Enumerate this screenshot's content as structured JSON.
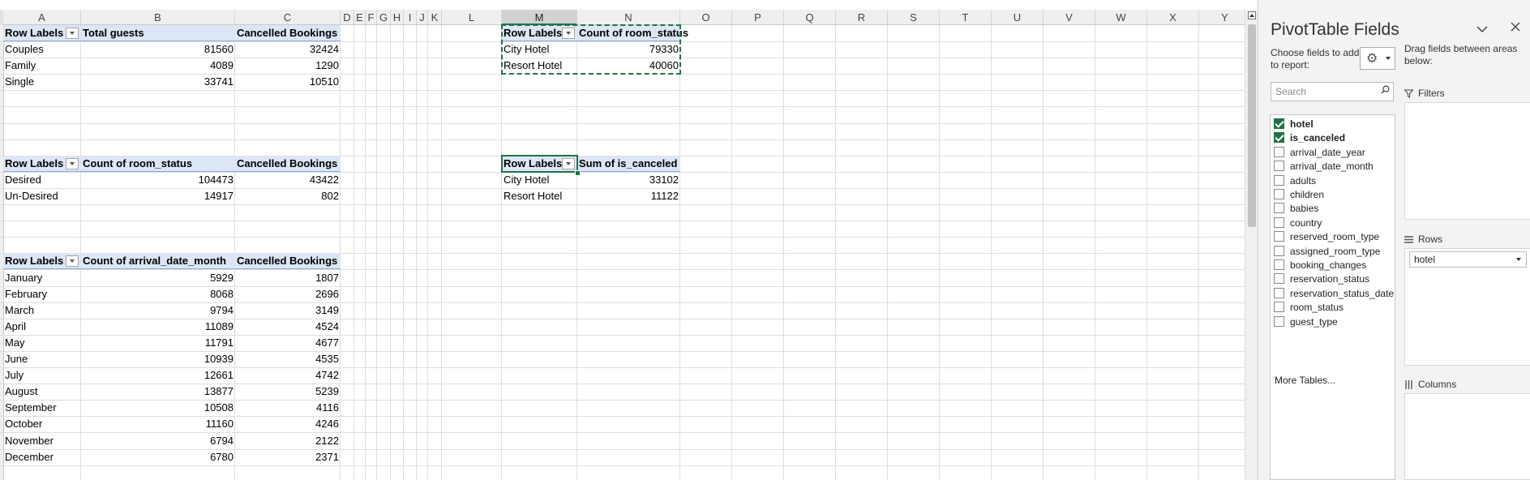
{
  "sheet": {
    "columns": [
      "A",
      "B",
      "C",
      "D",
      "E",
      "F",
      "G",
      "H",
      "I",
      "J",
      "K",
      "L",
      "M",
      "N",
      "O",
      "P",
      "Q",
      "R",
      "S",
      "T",
      "U",
      "V",
      "W",
      "X",
      "Y"
    ],
    "tables": {
      "guests": {
        "headers": [
          "Row Labels",
          "Total guests",
          "Cancelled Bookings"
        ],
        "rows": [
          [
            "Couples",
            "81560",
            "32424"
          ],
          [
            "Family",
            "4089",
            "1290"
          ],
          [
            "Single",
            "33741",
            "10510"
          ]
        ]
      },
      "room_status": {
        "headers": [
          "Row Labels",
          "Count of room_status",
          "Cancelled Bookings"
        ],
        "rows": [
          [
            "Desired",
            "104473",
            "43422"
          ],
          [
            "Un-Desired",
            "14917",
            "802"
          ]
        ]
      },
      "months": {
        "headers": [
          "Row Labels",
          "Count of arrival_date_month",
          "Cancelled Bookings"
        ],
        "rows": [
          [
            "January",
            "5929",
            "1807"
          ],
          [
            "February",
            "8068",
            "2696"
          ],
          [
            "March",
            "9794",
            "3149"
          ],
          [
            "April",
            "11089",
            "4524"
          ],
          [
            "May",
            "11791",
            "4677"
          ],
          [
            "June",
            "10939",
            "4535"
          ],
          [
            "July",
            "12661",
            "4742"
          ],
          [
            "August",
            "13877",
            "5239"
          ],
          [
            "September",
            "10508",
            "4116"
          ],
          [
            "October",
            "11160",
            "4246"
          ],
          [
            "November",
            "6794",
            "2122"
          ],
          [
            "December",
            "6780",
            "2371"
          ]
        ]
      },
      "hotel_count": {
        "headers": [
          "Row Labels",
          "Count of room_status"
        ],
        "rows": [
          [
            "City Hotel",
            "79330"
          ],
          [
            "Resort Hotel",
            "40060"
          ]
        ]
      },
      "hotel_cancel": {
        "headers": [
          "Row Labels",
          "Sum of is_canceled"
        ],
        "rows": [
          [
            "City Hotel",
            "33102"
          ],
          [
            "Resort Hotel",
            "11122"
          ]
        ]
      }
    }
  },
  "pane": {
    "title": "PivotTable Fields",
    "choose_label": "Choose fields to add to report:",
    "drag_label": "Drag fields between areas below:",
    "search_placeholder": "Search",
    "fields": [
      {
        "name": "hotel",
        "checked": true
      },
      {
        "name": "is_canceled",
        "checked": true
      },
      {
        "name": "arrival_date_year",
        "checked": false
      },
      {
        "name": "arrival_date_month",
        "checked": false
      },
      {
        "name": "adults",
        "checked": false
      },
      {
        "name": "children",
        "checked": false
      },
      {
        "name": "babies",
        "checked": false
      },
      {
        "name": "country",
        "checked": false
      },
      {
        "name": "reserved_room_type",
        "checked": false
      },
      {
        "name": "assigned_room_type",
        "checked": false
      },
      {
        "name": "booking_changes",
        "checked": false
      },
      {
        "name": "reservation_status",
        "checked": false
      },
      {
        "name": "reservation_status_date",
        "checked": false
      },
      {
        "name": "room_status",
        "checked": false
      },
      {
        "name": "guest_type",
        "checked": false
      }
    ],
    "more_tables": "More Tables...",
    "areas": {
      "filters": "Filters",
      "rows": "Rows",
      "rows_value": "hotel",
      "columns": "Columns"
    },
    "icons": {
      "gear": "gear-icon",
      "search": "search-icon",
      "close": "close-icon",
      "collapse": "chevron-down-icon"
    },
    "accent_color": "#217346"
  }
}
